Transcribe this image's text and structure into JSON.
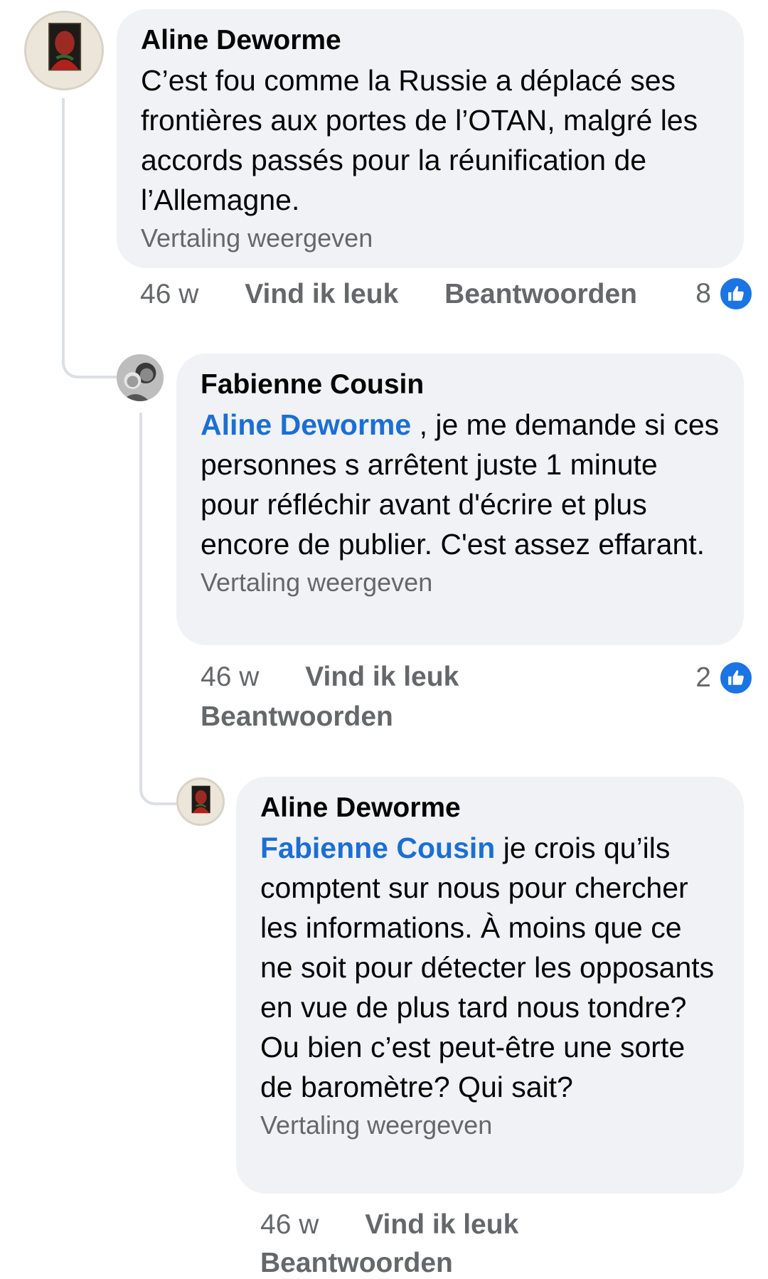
{
  "colors": {
    "accent": "#1b74e4",
    "bubble": "#f0f2f5",
    "meta": "#65676b"
  },
  "comments": [
    {
      "author": "Aline Deworme",
      "text": "C’est fou comme la Russie a déplacé ses frontières aux portes de l’OTAN, malgré les accords passés pour la réunification de l’Allemagne.",
      "translate_label": "Vertaling weergeven",
      "time": "46 w",
      "like_label": "Vind ik leuk",
      "reply_label": "Beantwoorden",
      "reaction_count": "8",
      "reaction_icon": "thumbs-up-icon"
    },
    {
      "author": "Fabienne Cousin",
      "mention": "Aline Deworme",
      "text": " , je me demande si ces personnes s arrêtent juste 1 minute pour réfléchir avant d'écrire et plus encore de publier. C'est assez effarant.",
      "translate_label": "Vertaling weergeven",
      "time": "46 w",
      "like_label": "Vind ik leuk",
      "reply_label": "Beantwoorden",
      "reaction_count": "2",
      "reaction_icon": "thumbs-up-icon"
    },
    {
      "author": "Aline Deworme",
      "mention": "Fabienne Cousin",
      "text": " je crois qu’ils comptent sur nous pour chercher les informations. À moins que ce ne soit pour détecter les opposants en vue de plus tard nous tondre? Ou bien c’est peut-être une sorte de baromètre? Qui sait?",
      "translate_label": "Vertaling weergeven",
      "time": "46 w",
      "like_label": "Vind ik leuk",
      "reply_label": "Beantwoorden"
    }
  ]
}
